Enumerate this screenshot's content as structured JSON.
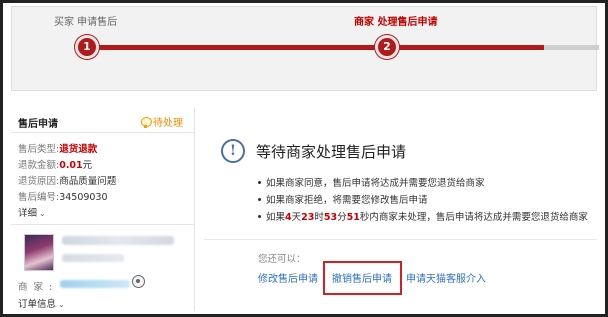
{
  "progress": {
    "steps": [
      {
        "number": "1",
        "label": "买家 申请售后",
        "state": "done"
      },
      {
        "number": "2",
        "label": "商家 处理售后申请",
        "state": "active"
      }
    ]
  },
  "left_panel": {
    "title": "售后申请",
    "status": "待处理",
    "rows": [
      {
        "key": "售后类型:",
        "value": "退货退款"
      },
      {
        "key": "退款金额:",
        "value": "0.01",
        "unit": "元"
      },
      {
        "key": "退货原因:",
        "value": "商品质量问题"
      },
      {
        "key": "售后编号:",
        "value": "34509030"
      }
    ],
    "detail_link": "详细",
    "seller_label": "商家:",
    "order_info": "订单信息"
  },
  "right_panel": {
    "title": "等待商家处理售后申请",
    "notices": [
      "如果商家同意，售后申请将达成并需要您退货给商家",
      "如果商家拒绝，将需要您修改售后申请"
    ],
    "countdown": {
      "prefix": "如果",
      "days": "4",
      "days_unit": "天",
      "hours": "23",
      "hours_unit": "时",
      "minutes": "53",
      "minutes_unit": "分",
      "seconds": "51",
      "seconds_unit": "秒",
      "suffix": "内商家未处理，售后申请将达成并需要您退货给商家"
    },
    "also_label": "您还可以：",
    "actions": [
      "修改售后申请",
      "撤销售后申请",
      "申请天猫客服介入"
    ]
  },
  "colors": {
    "accent_red": "#c40000",
    "progress_red": "#b01a1a",
    "link_blue": "#2c72c7",
    "pending_orange": "#f08c00",
    "highlight_box": "#d42020"
  }
}
